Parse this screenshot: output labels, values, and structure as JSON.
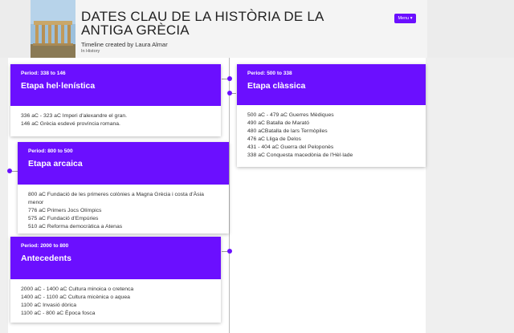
{
  "header": {
    "title": "DATES CLAU DE LA HISTÒRIA DE LA ANTIGA GRÈCIA",
    "byline": "Timeline created by Laura Almar",
    "category": "In History",
    "menu_label": "Menu ▾"
  },
  "cards": [
    {
      "period": "Period: 338 to 146",
      "era": "Etapa hel·lenística",
      "events": [
        "336 aC - 323 aC Imperi d'alexandre el gran.",
        "146 aC Grècia esdevé província romana."
      ]
    },
    {
      "period": "Period: 500 to 338",
      "era": "Etapa clàssica",
      "events": [
        "500 aC - 479 aC Guerres Mèdiques",
        "490 aC Batalla de Marató",
        "480 aCBatalla de lars Termòpiles",
        "476 aC Lliga de Delos",
        "431 - 404 aC Guerra del Peloponès",
        "338 aC Conquesta macedònia de l'Hèl·lade"
      ]
    },
    {
      "period": "Period: 800 to 500",
      "era": "Etapa arcaica",
      "events": [
        "800 aC Fundació de les primeres colònies a Magna Grècia i costa d'Àsia menor",
        "776 aC Primers Jocs Olímpics",
        "575 aC Fundació d'Empúries",
        "510 aC Reforma democràtica a Atenas"
      ]
    },
    {
      "period": "Period: 2000 to 800",
      "era": "Antecedents",
      "events": [
        "2000 aC - 1400 aC Cultura minoica o cretenca",
        "1400 aC - 1100 aC Cultura micènica o aquea",
        "1100 aC Invasió dòrica",
        "1100 aC - 800 aC Època fosca"
      ]
    }
  ],
  "colors": {
    "accent": "#6b0fff",
    "axis": "#b9b9b9"
  },
  "icons": {
    "thumbnail": "greek-temple-image",
    "menu": "chevron-down-icon",
    "timeline_marker": "dot-icon"
  }
}
